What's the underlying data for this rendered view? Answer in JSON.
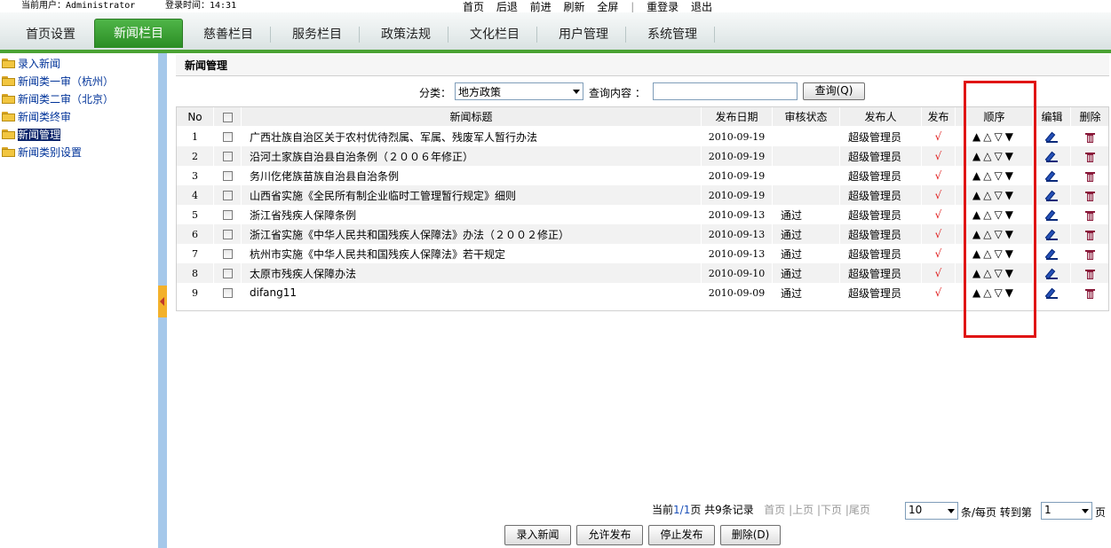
{
  "topbar": {
    "user": "当前用户：Administrator",
    "login_time": "登录时间：14:31",
    "links": [
      "首页",
      "后退",
      "前进",
      "刷新",
      "全屏",
      "重登录",
      "退出"
    ]
  },
  "nav": {
    "tabs": [
      "首页设置",
      "新闻栏目",
      "慈善栏目",
      "服务栏目",
      "政策法规",
      "文化栏目",
      "用户管理",
      "系统管理"
    ],
    "active": "新闻栏目"
  },
  "sidebar": {
    "items": [
      "录入新闻",
      "新闻类一审（杭州）",
      "新闻类二审（北京）",
      "新闻类终审",
      "新闻管理",
      "新闻类别设置"
    ],
    "current": "新闻管理"
  },
  "panel": {
    "title": "新闻管理"
  },
  "filter": {
    "category_label": "分类：",
    "category_value": "地方政策",
    "search_label": "查询内容 ：",
    "search_value": "",
    "query_button": "查询(Q)"
  },
  "table": {
    "headers": [
      "No",
      "",
      "新闻标题",
      "发布日期",
      "审核状态",
      "发布人",
      "发布",
      "顺序",
      "编辑",
      "删除"
    ],
    "order_symbols": "▲△▽▼",
    "publish_mark": "√",
    "rows": [
      {
        "no": "1",
        "title": "广西壮族自治区关于农村优待烈属、军属、残废军人暂行办法",
        "date": "2010-09-19",
        "status": "",
        "publisher": "超级管理员"
      },
      {
        "no": "2",
        "title": "沿河土家族自治县自治条例（２００６年修正）",
        "date": "2010-09-19",
        "status": "",
        "publisher": "超级管理员"
      },
      {
        "no": "3",
        "title": "务川仡佬族苗族自治县自治条例",
        "date": "2010-09-19",
        "status": "",
        "publisher": "超级管理员"
      },
      {
        "no": "4",
        "title": "山西省实施《全民所有制企业临时工管理暂行规定》细则",
        "date": "2010-09-19",
        "status": "",
        "publisher": "超级管理员"
      },
      {
        "no": "5",
        "title": "浙江省残疾人保障条例",
        "date": "2010-09-13",
        "status": "通过",
        "publisher": "超级管理员"
      },
      {
        "no": "6",
        "title": "浙江省实施《中华人民共和国残疾人保障法》办法（２００２修正）",
        "date": "2010-09-13",
        "status": "通过",
        "publisher": "超级管理员"
      },
      {
        "no": "7",
        "title": "杭州市实施《中华人民共和国残疾人保障法》若干规定",
        "date": "2010-09-13",
        "status": "通过",
        "publisher": "超级管理员"
      },
      {
        "no": "8",
        "title": "太原市残疾人保障办法",
        "date": "2010-09-10",
        "status": "通过",
        "publisher": "超级管理员"
      },
      {
        "no": "9",
        "title": "difang11",
        "date": "2010-09-09",
        "status": "通过",
        "publisher": "超级管理员"
      }
    ]
  },
  "pager": {
    "current_prefix": "当前",
    "current_page": "1/1",
    "page_suffix": "页  共9条记录",
    "first": "首页",
    "prev": "上页",
    "next": "下页",
    "last": "尾页",
    "page_size": "10",
    "per_page_label": "条/每页 转到第",
    "goto_page": "1",
    "page_label": "页"
  },
  "actions": {
    "add": "录入新闻",
    "allow": "允许发布",
    "stop": "停止发布",
    "delete": "删除(D)"
  },
  "colors": {
    "nav_accent": "#4aa233",
    "highlight_box": "#e01515",
    "publish_mark": "#e02020"
  }
}
